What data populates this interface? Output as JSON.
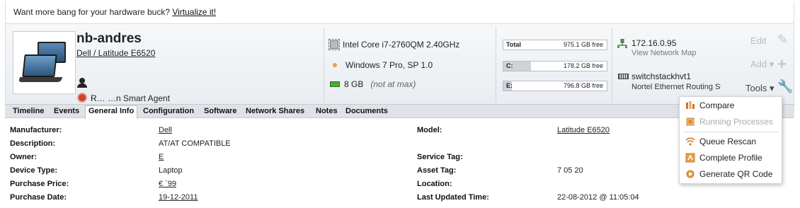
{
  "promo": {
    "text": "Want more bang for your hardware buck?",
    "link": "Virtualize it!"
  },
  "device": {
    "name": "nb-andres",
    "model": "Dell / Latitude E6520",
    "agent": "R… …n Smart Agent"
  },
  "hardware": {
    "cpu": "Intel Core i7-2760QM 2.40GHz",
    "os": "Windows 7 Pro, SP 1.0",
    "ram": "8 GB",
    "ram_note": "(not at max)"
  },
  "disks": [
    {
      "label": "Total",
      "free": "975.1 GB free",
      "used_fraction": 0.0
    },
    {
      "label": "C:",
      "free": "178.2 GB free",
      "used_fraction": 0.27
    },
    {
      "label": "E:",
      "free": "796.8 GB free",
      "used_fraction": 0.08
    }
  ],
  "network": {
    "ip": "172.16.0.95",
    "map_link": "View Network Map",
    "switch": "switchstackhvt1",
    "switch_vendor": "Nortel Ethernet Routing Sv"
  },
  "actions": {
    "edit": "Edit",
    "add": "Add",
    "tools": "Tools"
  },
  "tabs": [
    "Timeline",
    "Events",
    "General Info",
    "Configuration",
    "Software",
    "Network Shares",
    "Notes",
    "Documents"
  ],
  "active_tab": "General Info",
  "info_left": [
    {
      "key": "Manufacturer:",
      "value": "Dell"
    },
    {
      "key": "Description:",
      "value": "AT/AT COMPATIBLE"
    },
    {
      "key": "Owner:",
      "value": "E"
    },
    {
      "key": "Device Type:",
      "value": "Laptop"
    },
    {
      "key": "Purchase Price:",
      "value": "€  `99"
    },
    {
      "key": "Purchase Date:",
      "value": "19-12-2011"
    }
  ],
  "info_right": [
    {
      "key": "Model:",
      "value": "Latitude E6520"
    },
    {
      "key": "",
      "value": ""
    },
    {
      "key": "Service Tag:",
      "value": ""
    },
    {
      "key": "Asset Tag:",
      "value": "7   05   20"
    },
    {
      "key": "Location:",
      "value": ""
    },
    {
      "key": "Last Updated Time:",
      "value": "22-08-2012 @ 11:05:04"
    }
  ],
  "tools_menu": [
    {
      "label": "Compare",
      "icon": "compare-icon",
      "disabled": false
    },
    {
      "label": "Running Processes",
      "icon": "processes-icon",
      "disabled": true
    },
    {
      "label": "Queue Rescan",
      "icon": "rescan-icon",
      "disabled": false
    },
    {
      "label": "Complete Profile",
      "icon": "profile-icon",
      "disabled": false
    },
    {
      "label": "Generate QR Code",
      "icon": "qr-icon",
      "disabled": false
    }
  ],
  "colors": {
    "accent_orange": "#e8a14b",
    "ram_green": "#4caa3a",
    "tabbar": "#dfe3e8"
  }
}
